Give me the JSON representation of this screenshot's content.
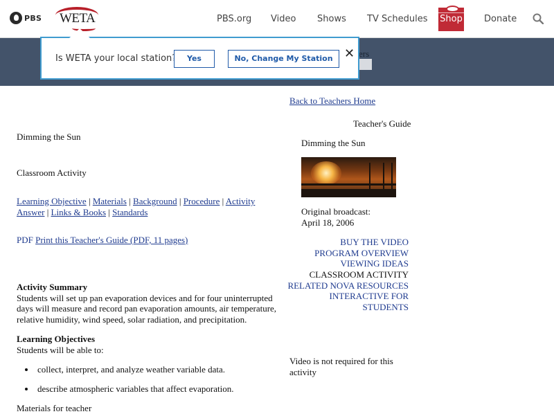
{
  "nav": {
    "logo_pbs": "PBS",
    "logo_weta": "WETA",
    "links": [
      "PBS.org",
      "Video",
      "Shows",
      "TV Schedules"
    ],
    "shop": "Shop",
    "donate": "Donate"
  },
  "banner": {
    "fragment": "ers"
  },
  "popup": {
    "question": "Is WETA your local station?",
    "yes": "Yes",
    "change": "No, Change My Station",
    "close": "✕"
  },
  "left": {
    "title": "Dimming the Sun",
    "subtitle": "Classroom Activity",
    "toc": [
      "Learning Objective",
      "Materials",
      "Background",
      "Procedure",
      "Activity Answer",
      "Links & Books",
      "Standards"
    ],
    "pdf_label": "PDF",
    "pdf_link": "Print this Teacher's Guide (PDF, 11 pages)",
    "summary_heading": "Activity Summary",
    "summary_lines": [
      "Students will set up pan evaporation devices and for four uninterrupted",
      "days will measure and record pan evaporation amounts, air temperature,",
      "relative humidity, wind speed, solar radiation, and precipitation."
    ],
    "objectives_heading": "Learning Objectives",
    "objectives_intro": "Students will be able to:",
    "objectives": [
      "collect, interpret, and analyze weather variable data.",
      "describe atmospheric variables that affect evaporation."
    ],
    "materials_heading": "Materials for teacher"
  },
  "right": {
    "back_link": "Back to Teachers Home",
    "guide_label": "Teacher's Guide",
    "program_title": "Dimming the Sun",
    "broadcast_label": "Original broadcast:",
    "broadcast_date": "April 18, 2006",
    "menu": [
      "BUY THE VIDEO",
      "PROGRAM OVERVIEW",
      "VIEWING IDEAS",
      "CLASSROOM ACTIVITY",
      "RELATED NOVA RESOURCES",
      "INTERACTIVE FOR",
      "STUDENTS"
    ],
    "note_lines": [
      "Video is not required for this",
      "activity"
    ]
  }
}
